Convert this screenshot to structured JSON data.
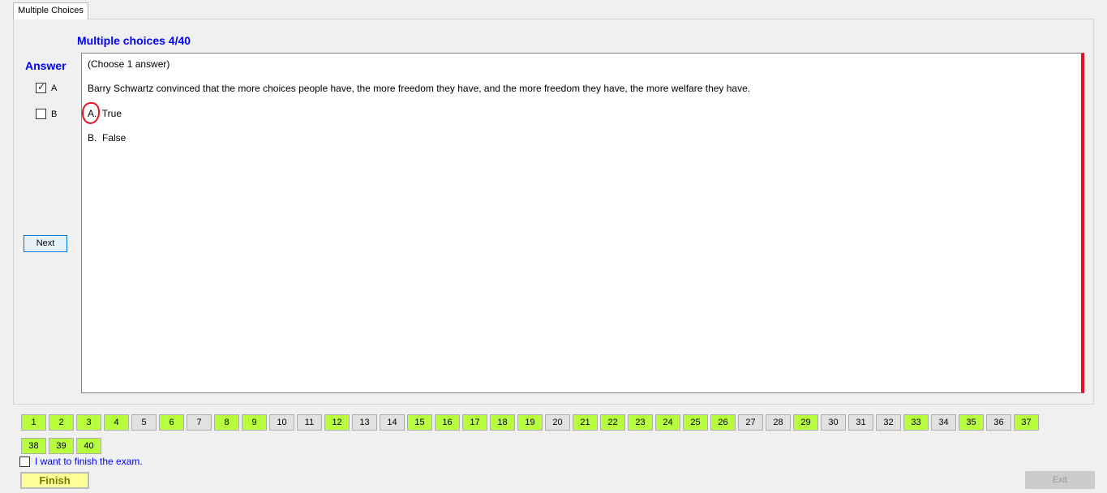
{
  "tab": {
    "label": "Multiple Choices"
  },
  "question": {
    "title": "Multiple choices 4/40",
    "instruction": "(Choose 1 answer)",
    "text": "Barry Schwartz convinced that the more choices people have, the more freedom they have, and the more freedom they have, the more welfare they have.",
    "options": [
      {
        "letter": "A.",
        "text": "True"
      },
      {
        "letter": "B.",
        "text": "False"
      }
    ]
  },
  "answer": {
    "label": "Answer",
    "choices": [
      {
        "label": "A",
        "checked": true
      },
      {
        "label": "B",
        "checked": false
      }
    ]
  },
  "next_label": "Next",
  "nav": {
    "numbers": [
      "1",
      "2",
      "3",
      "4",
      "5",
      "6",
      "7",
      "8",
      "9",
      "10",
      "11",
      "12",
      "13",
      "14",
      "15",
      "16",
      "17",
      "18",
      "19",
      "20",
      "21",
      "22",
      "23",
      "24",
      "25",
      "26",
      "27",
      "28",
      "29",
      "30",
      "31",
      "32",
      "33",
      "34",
      "35",
      "36",
      "37",
      "38",
      "39",
      "40"
    ],
    "answered": [
      1,
      2,
      3,
      4,
      6,
      8,
      9,
      12,
      15,
      16,
      17,
      18,
      19,
      21,
      22,
      23,
      24,
      25,
      26,
      29,
      33,
      35,
      37,
      38,
      39,
      40
    ]
  },
  "finish_checkbox_label": "I want to finish the exam.",
  "finish_label": "Finish",
  "exit_label": "Exit",
  "colors": {
    "accent_blue": "#0000ff",
    "answered_green": "#b7ff3c",
    "red_bar": "#e81123",
    "finish_yellow": "#ffff99"
  }
}
